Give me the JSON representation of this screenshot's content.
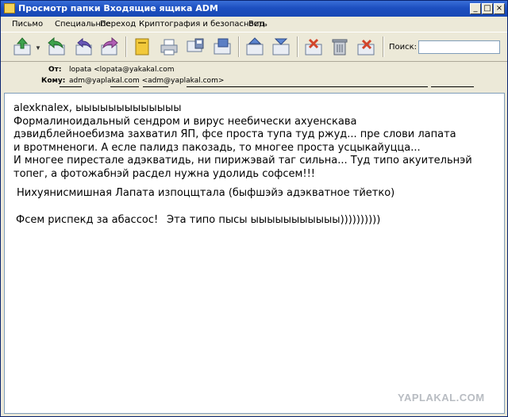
{
  "window": {
    "title": "Просмотр папки Входящие ящика ADM",
    "controls": {
      "minimize": "_",
      "maximize": "□",
      "close": "×"
    }
  },
  "menu": [
    "Письмо",
    "Специальное",
    "Переход",
    "Криптография и безопасность",
    "Вид"
  ],
  "toolbar": {
    "buttons": [
      "receive-icon",
      "reply-icon",
      "reply-all-icon",
      "forward-icon",
      "address-book-icon",
      "print-icon",
      "save-icon",
      "previous-icon",
      "next-icon",
      "move-icon",
      "delete-icon",
      "purge-icon"
    ],
    "search_label": "Поиск:",
    "search_value": ""
  },
  "header": {
    "from_label": "От:",
    "from_value": "lopata  <lopata@yakakal.com",
    "to_label": "Кому:",
    "to_value": "adm@yaplakal.com <adm@yaplakal.com>"
  },
  "message": {
    "body": "alexknalex, ыыыыыыыыыыыыы\nФормалиноидальный сендром и вирус неебически ахуенскава\nдэвидблейноебизма захватил ЯП, фсе проста тупа туд ржуд... пре слови лапата\nи вротмненоги. А есле палидз пакозадь, то многее проста усцыкайуцца...\nИ многее пирестале адэкватидь, ни пирижэвай таг сильна... Туд типо акуительнэй\nтопег, а фотожабнэй расдел нужна удолидь софсем!!!",
    "signature_line": "Нихуянисмишная Лапата изпоцщтала (быфшэйэ адэкватное тйетко)",
    "greeting": "Фсем риспекд за абассос!",
    "closing": "Эта типо пысы ыыыыыыыыыыы))))))))))"
  },
  "watermark": "YAPLAKAL.COM"
}
